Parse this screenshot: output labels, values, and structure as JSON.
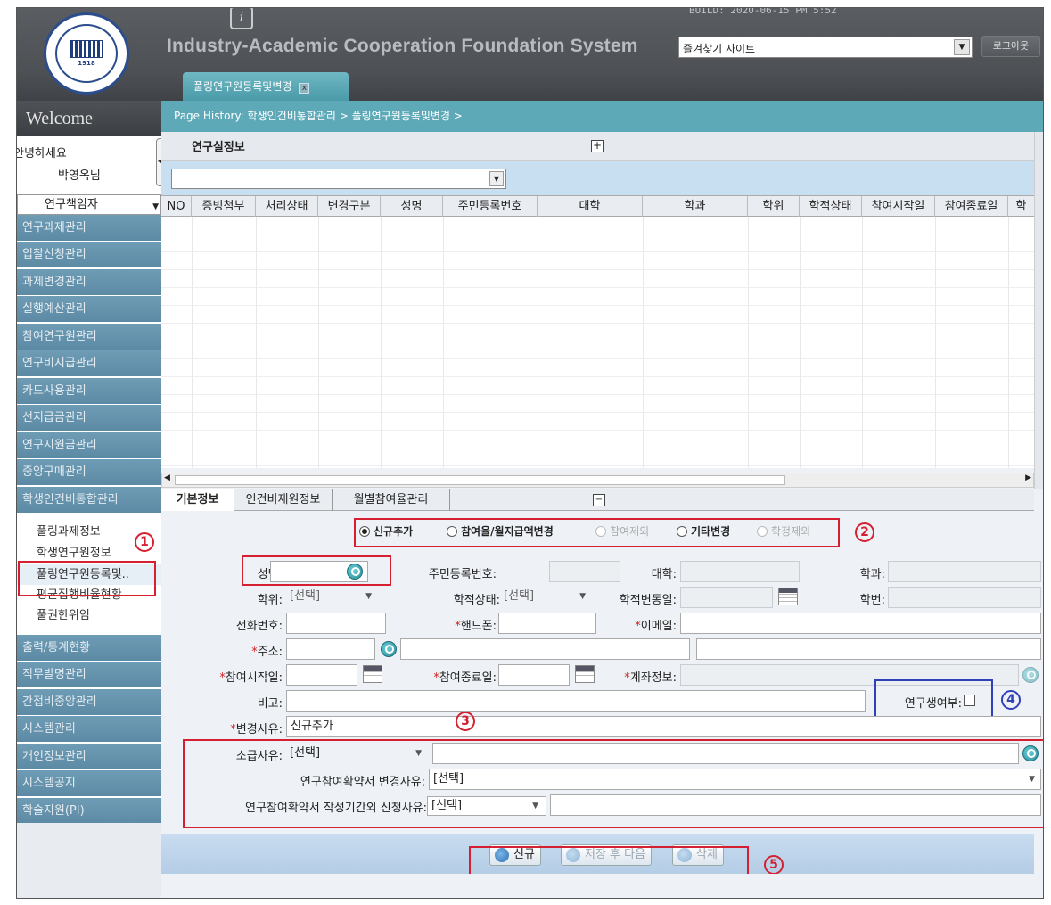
{
  "header": {
    "build": "BUILD: 2020-06-15 PM 5:52",
    "system_title": "Industry-Academic Cooperation Foundation System",
    "favorites_label": "즐겨찾기 사이트",
    "logout_label": "로그아웃",
    "info_label": "i",
    "logo_year": "1918",
    "open_tab": "풀링연구원등록및변경",
    "tab_close": "x"
  },
  "sidebar": {
    "welcome": "Welcome",
    "greeting": "안녕하세요",
    "user_name": "박영옥님",
    "role": "연구책임자",
    "menu": [
      "연구과제관리",
      "입찰신청관리",
      "과제변경관리",
      "실행예산관리",
      "참여연구원관리",
      "연구비지급관리",
      "카드사용관리",
      "선지급금관리",
      "연구지원금관리",
      "중앙구매관리",
      "학생인건비통합관리"
    ],
    "submenu": [
      "풀링과제정보",
      "학생연구원정보",
      "풀링연구원등록및..",
      "평균집행비율현황",
      "풀권한위임"
    ],
    "menu2": [
      "출력/통계현황",
      "직무발명관리",
      "간접비중앙관리",
      "시스템관리",
      "개인정보관리",
      "시스템공지",
      "학술지원(PI)"
    ]
  },
  "history": "Page History:  학생인건비통합관리 > 풀링연구원등록및변경 >",
  "grid": {
    "title": "연구실정보",
    "expand_icon": "+",
    "columns": [
      "NO",
      "증빙첨부",
      "처리상태",
      "변경구분",
      "성명",
      "주민등록번호",
      "대학",
      "학과",
      "학위",
      "학적상태",
      "참여시작일",
      "참여종료일",
      "학"
    ]
  },
  "detail_tabs": [
    "기본정보",
    "인건비재원정보",
    "월별참여율관리"
  ],
  "collapse_icon": "−",
  "radios": [
    {
      "label": "신규추가",
      "checked": true,
      "disabled": false
    },
    {
      "label": "참여율/월지급액변경",
      "checked": false,
      "disabled": false
    },
    {
      "label": "참여제외",
      "checked": false,
      "disabled": true
    },
    {
      "label": "기타변경",
      "checked": false,
      "disabled": false
    },
    {
      "label": "학정제외",
      "checked": false,
      "disabled": true
    }
  ],
  "form": {
    "name_label": "성명:",
    "rrn_label": "주민등록번호:",
    "univ_label": "대학:",
    "dept_label": "학과:",
    "degree_label": "학위:",
    "degree_value": "[선택]",
    "acad_status_label": "학적상태:",
    "acad_status_value": "[선택]",
    "acad_change_label": "학적변동일:",
    "student_no_label": "학번:",
    "phone_label": "전화번호:",
    "mobile_label": "핸드폰:",
    "email_label": "이메일:",
    "address_label": "주소:",
    "start_label": "참여시작일:",
    "end_label": "참여종료일:",
    "account_label": "계좌정보:",
    "note_label": "비고:",
    "student_researcher_label": "연구생여부:",
    "change_reason_label": "변경사유:",
    "change_reason_value": "신규추가",
    "retro_reason_label": "소급사유:",
    "retro_reason_value": "[선택]",
    "agreement_change_label": "연구참여확약서 변경사유:",
    "agreement_change_value": "[선택]",
    "agreement_late_label": "연구참여확약서 작성기간외 신청사유:",
    "agreement_late_value": "[선택]",
    "required_mark": "*"
  },
  "buttons": {
    "new": "신규",
    "save_next": "저장 후 다음",
    "delete": "삭제"
  },
  "annotations": [
    "1",
    "2",
    "3",
    "4",
    "5"
  ]
}
